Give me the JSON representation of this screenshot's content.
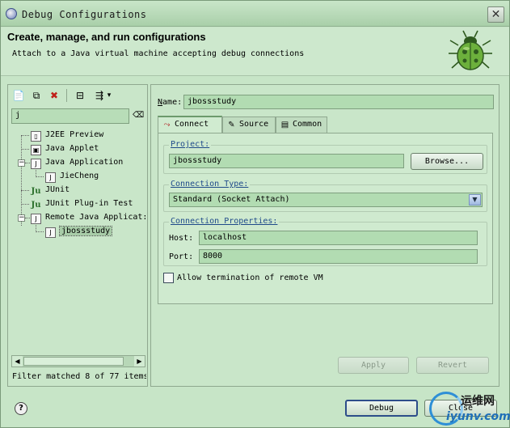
{
  "window": {
    "title": "Debug Configurations",
    "close_glyph": "✕"
  },
  "header": {
    "title": "Create, manage, and run configurations",
    "description": "Attach to a Java virtual machine accepting debug connections",
    "icon": "debug-bug-icon"
  },
  "left_panel": {
    "toolbar": [
      {
        "name": "new-configuration-icon",
        "glyph": "📄"
      },
      {
        "name": "duplicate-icon",
        "glyph": "⧉"
      },
      {
        "name": "delete-icon",
        "glyph": "✖"
      },
      {
        "name": "collapse-all-icon",
        "glyph": "⊟"
      },
      {
        "name": "filter-configurations-icon",
        "glyph": "⇶"
      },
      {
        "name": "dropdown-icon",
        "glyph": "▾"
      }
    ],
    "filter_value": "j",
    "tree": [
      {
        "label": "J2EE Preview",
        "icon": "j2ee-preview-icon",
        "glyph": "▯"
      },
      {
        "label": "Java Applet",
        "icon": "java-applet-icon",
        "glyph": "▣"
      },
      {
        "label": "Java Application",
        "icon": "java-application-icon",
        "glyph": "J",
        "expanded": true
      },
      {
        "label": "JieCheng",
        "icon": "java-config-icon",
        "glyph": "J",
        "child": true
      },
      {
        "label": "JUnit",
        "icon": "junit-icon",
        "glyph": "Ju"
      },
      {
        "label": "JUnit Plug-in Test",
        "icon": "junit-plugin-icon",
        "glyph": "Ju"
      },
      {
        "label": "Remote Java Applicat:",
        "icon": "remote-java-icon",
        "glyph": "J",
        "expanded": true
      },
      {
        "label": "jbossstudy",
        "icon": "remote-config-icon",
        "glyph": "J",
        "child": true,
        "selected": true
      }
    ],
    "filter_message": "Filter matched 8 of 77 items"
  },
  "right_panel": {
    "name_label": "Name:",
    "name_mnemonic": "N",
    "name_value": "jbossstudy",
    "tabs": [
      {
        "label": "Connect",
        "icon": "connect-icon",
        "glyph": "⤳",
        "active": true
      },
      {
        "label": "Source",
        "icon": "source-icon",
        "glyph": "✎"
      },
      {
        "label": "Common",
        "icon": "common-icon",
        "glyph": "▤"
      }
    ],
    "project": {
      "title": "Project:",
      "value": "jbossstudy",
      "browse_label": "Browse..."
    },
    "connection_type": {
      "title": "Connection Type:",
      "value": "Standard (Socket Attach)"
    },
    "connection_properties": {
      "title": "Connection Properties:",
      "host_label": "Host:",
      "host_value": "localhost",
      "port_label": "Port:",
      "port_value": "8000"
    },
    "allow_termination_label": "Allow termination of remote VM",
    "allow_termination_checked": false,
    "apply_label": "Apply",
    "revert_label": "Revert"
  },
  "footer": {
    "help_glyph": "?",
    "debug_label": "Debug",
    "close_label": "Close"
  },
  "watermark": {
    "line1": "运维网",
    "line2": "iyunv.com"
  }
}
